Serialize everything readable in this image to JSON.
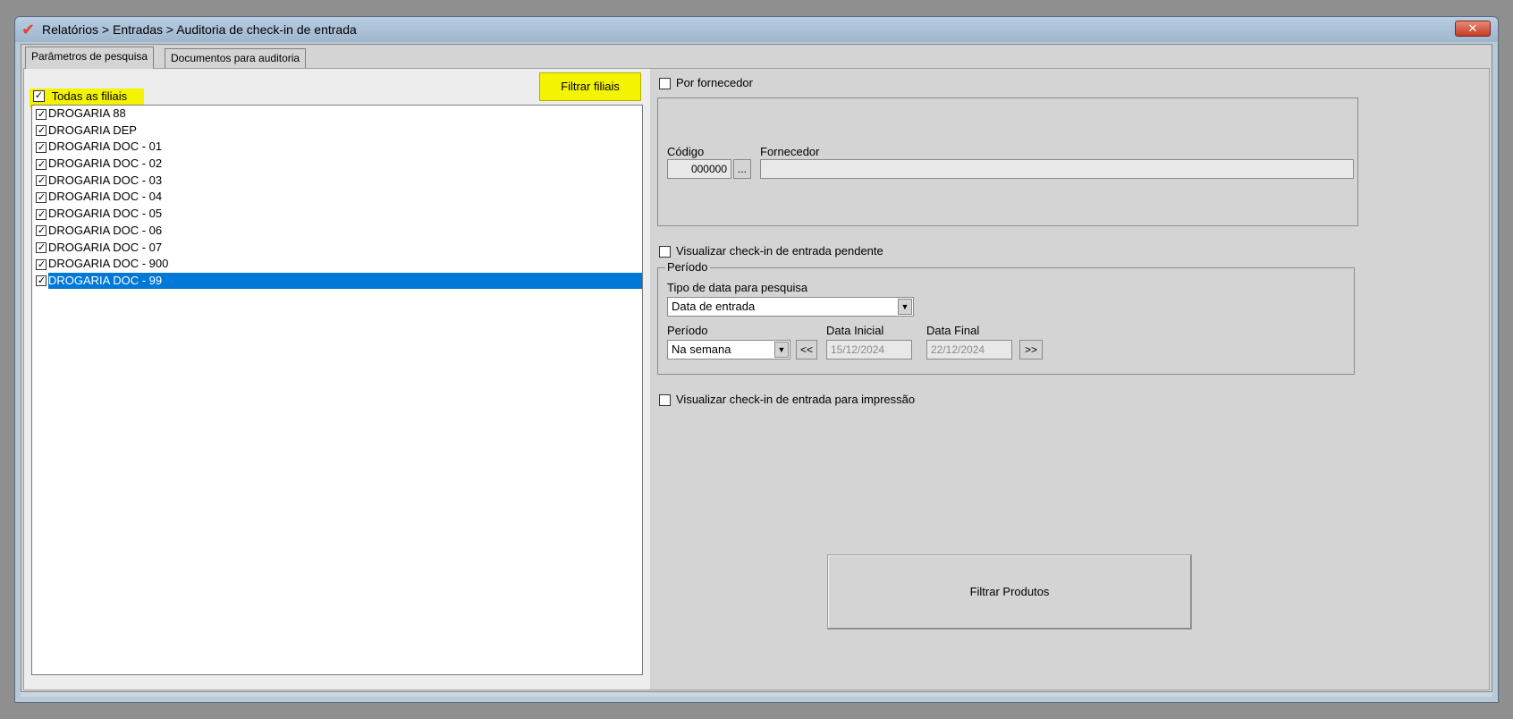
{
  "window": {
    "title": "Relatórios > Entradas > Auditoria de check-in de entrada",
    "close_label": "✕"
  },
  "tabs": [
    {
      "label": "Parâmetros de pesquisa",
      "active": true
    },
    {
      "label": "Documentos para auditoria",
      "active": false
    }
  ],
  "filiais": {
    "all_label": "Todas as filiais",
    "all_checked": true,
    "filter_button": "Filtrar filiais",
    "items": [
      {
        "label": "DROGARIA 88",
        "checked": true
      },
      {
        "label": "DROGARIA DEP",
        "checked": true
      },
      {
        "label": "DROGARIA DOC - 01",
        "checked": true
      },
      {
        "label": "DROGARIA DOC - 02",
        "checked": true
      },
      {
        "label": "DROGARIA DOC - 03",
        "checked": true
      },
      {
        "label": "DROGARIA DOC - 04",
        "checked": true
      },
      {
        "label": "DROGARIA DOC - 05",
        "checked": true
      },
      {
        "label": "DROGARIA DOC - 06",
        "checked": true
      },
      {
        "label": "DROGARIA DOC - 07",
        "checked": true
      },
      {
        "label": "DROGARIA DOC - 900",
        "checked": true
      },
      {
        "label": "DROGARIA DOC - 99",
        "checked": true,
        "selected": true
      }
    ]
  },
  "fornecedor": {
    "checkbox_label": "Por fornecedor",
    "codigo_label": "Código",
    "codigo_value": "000000",
    "lookup_button": "...",
    "fornecedor_label": "Fornecedor",
    "fornecedor_value": ""
  },
  "pendente": {
    "checkbox_label": "Visualizar check-in de entrada pendente"
  },
  "periodo": {
    "group_label": "Período",
    "tipo_data_label": "Tipo de data para pesquisa",
    "tipo_data_value": "Data de entrada",
    "periodo_label": "Período",
    "periodo_value": "Na semana",
    "prev_button": "<<",
    "next_button": ">>",
    "data_inicial_label": "Data Inicial",
    "data_inicial_value": "15/12/2024",
    "data_final_label": "Data Final",
    "data_final_value": "22/12/2024"
  },
  "impressao": {
    "checkbox_label": "Visualizar check-in de entrada para impressão"
  },
  "filtrar_produtos_label": "Filtrar Produtos"
}
